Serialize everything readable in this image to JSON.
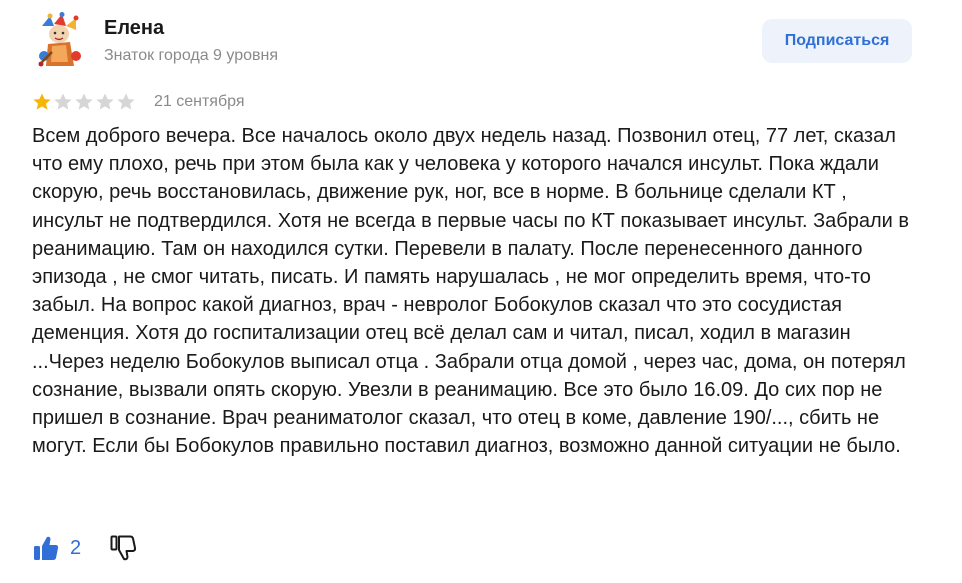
{
  "author": {
    "name": "Елена",
    "level": "Знаток города 9 уровня"
  },
  "subscribe_label": "Подписаться",
  "rating": {
    "value": 1,
    "max": 5
  },
  "date": "21 сентября",
  "review_text": "Всем доброго вечера. Все началось около двух недель назад. Позвонил отец, 77 лет, сказал что ему плохо, речь при этом была как у человека у которого начался инсульт. Пока ждали скорую, речь восстановилась, движение рук, ног, все в норме. В больнице сделали КТ , инсульт не подтвердился. Хотя не всегда в первые часы по КТ показывает инсульт. Забрали в реанимацию. Там он находился сутки. Перевели в палату. После перенесенного данного эпизода , не смог читать, писать. И память нарушалась , не мог определить время, что-то забыл. На вопрос какой диагноз, врач - невролог Бобокулов сказал что это сосудистая деменция. Хотя до госпитализации отец всё делал сам и читал, писал, ходил в магазин ...Через неделю Бобокулов выписал отца . Забрали отца домой , через час, дома, он потерял сознание, вызвали опять скорую. Увезли в реанимацию. Все это было 16.09. До сих пор не пришел в сознание. Врач реаниматолог сказал, что отец в коме, давление 190/..., сбить не могут. Если бы Бобокулов правильно поставил диагноз, возможно данной ситуации не было.",
  "likes": {
    "count": "2"
  },
  "icons": {
    "avatar": "avatar-image",
    "star_filled": "star-filled-icon",
    "star_empty": "star-empty-icon",
    "like": "thumbs-up-icon",
    "dislike": "thumbs-down-icon"
  },
  "colors": {
    "accent": "#2f6fd6",
    "star_filled": "#f6b604",
    "star_empty": "#d6d6d6",
    "muted_text": "#8a8a8a",
    "button_bg": "#eef3fb"
  }
}
